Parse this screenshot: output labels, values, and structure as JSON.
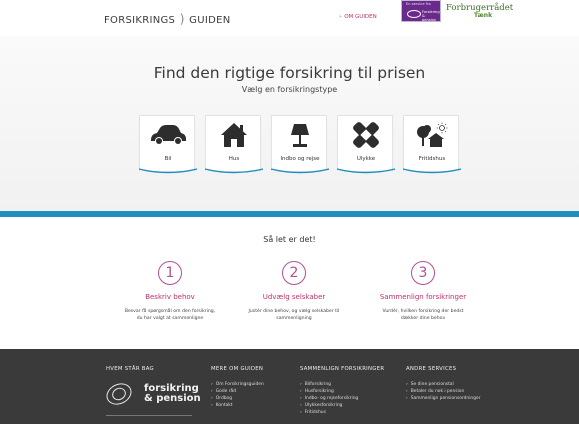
{
  "header": {
    "logo_left": "FORSIKRINGS",
    "logo_sep": ")",
    "logo_right": "GUIDEN",
    "om_link": "OM GUIDEN",
    "badge_top": "En service fra",
    "badge_line1": "Forsikring",
    "badge_line2": "& pension",
    "forbruger_title": "Forbrugerrådet",
    "forbruger_sub": "Tænk"
  },
  "hero": {
    "title": "Find den rigtige forsikring til prisen",
    "subtitle": "Vælg en forsikringstype",
    "tiles": [
      {
        "label": "Bil",
        "icon": "car-icon"
      },
      {
        "label": "Hus",
        "icon": "house-icon"
      },
      {
        "label": "Indbo og rejse",
        "icon": "lamp-icon"
      },
      {
        "label": "Ulykke",
        "icon": "bandage-icon"
      },
      {
        "label": "Fritidshus",
        "icon": "tree-house-icon"
      }
    ],
    "accent": "#1f8fbd"
  },
  "steps": {
    "title": "Så let er det!",
    "items": [
      {
        "num": "1",
        "title": "Beskriv behov",
        "text1": "Besvar få spørgsmål om den forsikring,",
        "text2": "du har valgt at sammenligne"
      },
      {
        "num": "2",
        "title": "Udvælg selskaber",
        "text1": "Justér dine behov, og vælg selskaber til",
        "text2": "sammenligning"
      },
      {
        "num": "3",
        "title": "Sammenlign forsikringer",
        "text1": "Vurdér, hvilken forsikring der bedst",
        "text2": "dækker dine behov"
      }
    ],
    "accent": "#b04f98"
  },
  "footer": {
    "col1": {
      "heading": "HVEM STÅR BAG",
      "logo_line1": "forsikring",
      "logo_line2": "& pension"
    },
    "col2": {
      "heading": "MERE OM GUIDEN",
      "items": [
        "Om Forsikringsguiden",
        "Gode råd",
        "Ordbog",
        "Kontakt"
      ]
    },
    "col3": {
      "heading": "SAMMENLIGN FORSIKRINGER",
      "items": [
        "Bilforsikring",
        "Husforsikring",
        "Indbo- og rejseforsikring",
        "Ulykkesforsikring",
        "Fritidshus"
      ]
    },
    "col4": {
      "heading": "ANDRE SERVICES",
      "items": [
        "Se dine pensionstal",
        "Betaler du nok i pension",
        "Sammenlign pensionsordninger"
      ]
    }
  }
}
